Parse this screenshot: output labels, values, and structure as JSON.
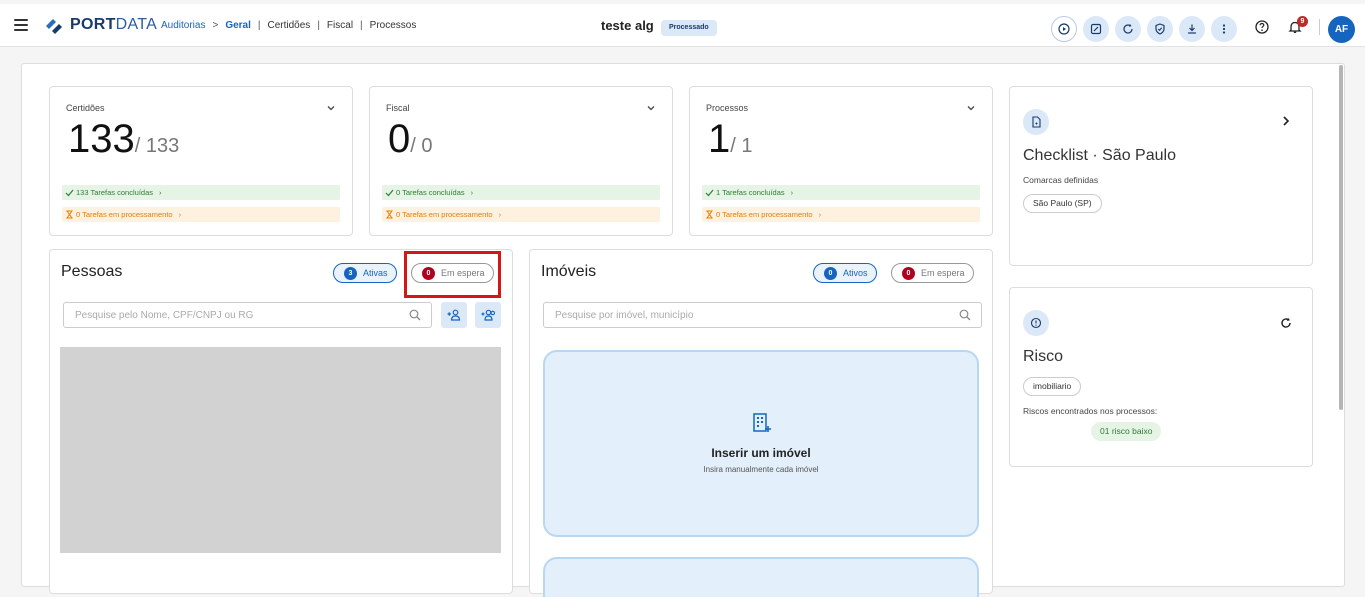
{
  "header": {
    "logo_bold": "PORT",
    "logo_thin": "DATA",
    "breadcrumb": [
      "Auditorias",
      ">",
      "Geral",
      "|",
      "Certidões",
      "|",
      "Fiscal",
      "|",
      "Processos"
    ],
    "title": "teste alg",
    "status": "Processado",
    "notifications_count": "9",
    "avatar_initials": "AF",
    "actions": [
      "play-icon",
      "edit-icon",
      "refresh-icon",
      "shield-icon",
      "download-icon",
      "more-icon"
    ],
    "accent": "#1565c0"
  },
  "stats": [
    {
      "label": "Certidões",
      "value": "133",
      "total": "/ 133",
      "done": "133 Tarefas concluídas",
      "processing": "0 Tarefas em processamento"
    },
    {
      "label": "Fiscal",
      "value": "0",
      "total": "/ 0",
      "done": "0 Tarefas concluídas",
      "processing": "0 Tarefas em processamento"
    },
    {
      "label": "Processos",
      "value": "1",
      "total": "/ 1",
      "done": "1 Tarefas concluídas",
      "processing": "0 Tarefas em processamento"
    }
  ],
  "pessoas": {
    "title": "Pessoas",
    "active_count": "3",
    "active_label": "Ativas",
    "wait_count": "0",
    "wait_label": "Em espera",
    "search_placeholder": "Pesquise pelo Nome, CPF/CNPJ ou RG"
  },
  "imoveis": {
    "title": "Imóveis",
    "active_count": "0",
    "active_label": "Ativos",
    "wait_count": "0",
    "wait_label": "Em espera",
    "search_placeholder": "Pesquise por imóvel, município",
    "insert_title": "Inserir um imóvel",
    "insert_sub": "Insira manualmente cada imóvel"
  },
  "checklist": {
    "title": "Checklist · São Paulo",
    "subtitle": "Comarcas definidas",
    "chip": "São Paulo (SP)"
  },
  "risco": {
    "title": "Risco",
    "chip": "imobiliario",
    "subtitle": "Riscos encontrados nos processos:",
    "result": "01 risco baixo"
  }
}
